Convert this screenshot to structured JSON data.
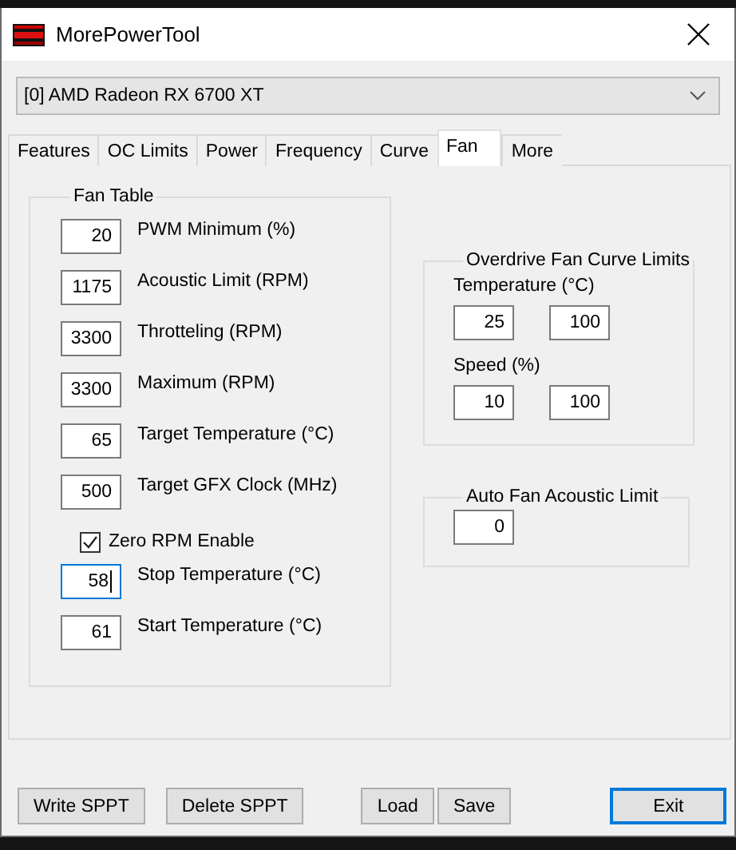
{
  "window": {
    "title": "MorePowerTool"
  },
  "device_select": {
    "value": "[0] AMD Radeon RX 6700 XT"
  },
  "tabs": [
    {
      "label": "Features",
      "selected": false
    },
    {
      "label": "OC Limits",
      "selected": false
    },
    {
      "label": "Power",
      "selected": false
    },
    {
      "label": "Frequency",
      "selected": false
    },
    {
      "label": "Curve",
      "selected": false
    },
    {
      "label": "Fan",
      "selected": true
    },
    {
      "label": "More",
      "selected": false
    }
  ],
  "fan_table": {
    "title": "Fan Table",
    "rows": [
      {
        "kind": "field",
        "value": "20",
        "label": "PWM Minimum (%)",
        "focused": false
      },
      {
        "kind": "field",
        "value": "1175",
        "label": "Acoustic Limit (RPM)",
        "focused": false
      },
      {
        "kind": "field",
        "value": "3300",
        "label": "Throtteling (RPM)",
        "focused": false
      },
      {
        "kind": "field",
        "value": "3300",
        "label": "Maximum (RPM)",
        "focused": false
      },
      {
        "kind": "field",
        "value": "65",
        "label": "Target Temperature (°C)",
        "focused": false
      },
      {
        "kind": "field",
        "value": "500",
        "label": "Target GFX Clock (MHz)",
        "focused": false
      },
      {
        "kind": "checkbox",
        "label": "Zero RPM Enable",
        "checked": true
      },
      {
        "kind": "field",
        "value": "58",
        "label": "Stop Temperature (°C)",
        "focused": true
      },
      {
        "kind": "field",
        "value": "61",
        "label": "Start Temperature (°C)",
        "focused": false
      }
    ]
  },
  "overdrive_limits": {
    "title": "Overdrive Fan Curve Limits",
    "groups": [
      {
        "label": "Temperature (°C)",
        "values": [
          "25",
          "100"
        ]
      },
      {
        "label": "Speed (%)",
        "values": [
          "10",
          "100"
        ]
      }
    ]
  },
  "auto_fan": {
    "title": "Auto Fan Acoustic Limit",
    "value": "0"
  },
  "button_groups": [
    [
      {
        "label": "Write SPPT",
        "default": false
      }
    ],
    [
      {
        "label": "Delete SPPT",
        "default": false
      }
    ],
    [
      {
        "label": "Load",
        "default": false
      },
      {
        "label": "Save",
        "default": false
      }
    ],
    [
      {
        "label": "Exit",
        "default": true
      }
    ]
  ]
}
